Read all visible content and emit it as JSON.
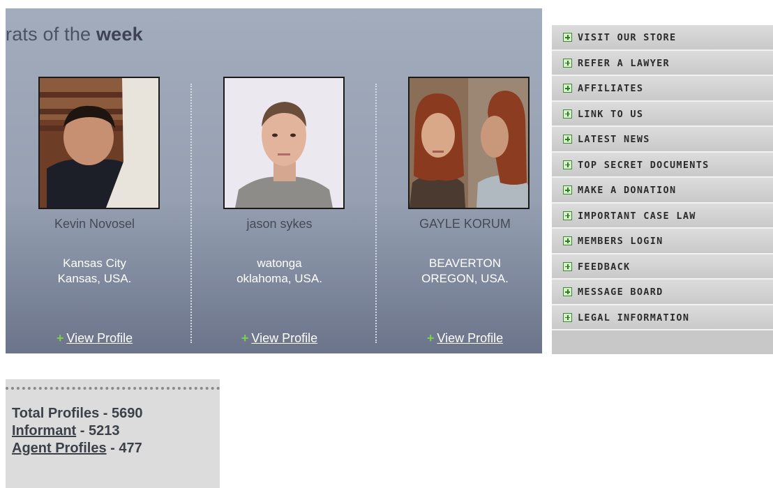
{
  "featured": {
    "title_prefix": "rats of the ",
    "title_bold": "week",
    "profiles": [
      {
        "name": "Kevin Novosel",
        "city": "Kansas City",
        "region": "Kansas, USA.",
        "action_plus": "+",
        "action_label": "View Profile"
      },
      {
        "name": "jason sykes",
        "city": "watonga",
        "region": "oklahoma, USA.",
        "action_plus": "+",
        "action_label": "View Profile"
      },
      {
        "name": "GAYLE KORUM",
        "city": "BEAVERTON",
        "region": "OREGON, USA.",
        "action_plus": "+",
        "action_label": "View Profile"
      }
    ]
  },
  "menu": {
    "items": [
      {
        "label": "VISIT OUR STORE"
      },
      {
        "label": "REFER A LAWYER"
      },
      {
        "label": "AFFILIATES"
      },
      {
        "label": "LINK TO US"
      },
      {
        "label": "LATEST NEWS"
      },
      {
        "label": "TOP SECRET DOCUMENTS"
      },
      {
        "label": "MAKE A DONATION"
      },
      {
        "label": "IMPORTANT CASE LAW"
      },
      {
        "label": "MEMBERS LOGIN"
      },
      {
        "label": "FEEDBACK"
      },
      {
        "label": "MESSAGE BOARD"
      },
      {
        "label": "LEGAL INFORMATION"
      }
    ],
    "icon": "plus-box-icon"
  },
  "stats": {
    "total_label": "Total Profiles",
    "total_value": "- 5690",
    "informant_label": "Informant",
    "informant_value": "- 5213",
    "agent_label": "Agent Profiles",
    "agent_value": "- 477"
  },
  "colors": {
    "panel_top": "#a2acbc",
    "panel_bottom": "#6b748a",
    "plus_green": "#7dcf4f",
    "menu_bg": "#c8c8c8"
  }
}
